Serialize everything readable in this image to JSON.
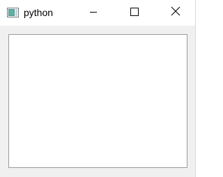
{
  "window": {
    "title": "python",
    "icon": "tk-window-icon",
    "controls": {
      "minimize_icon": "minimize-icon",
      "maximize_icon": "maximize-icon",
      "close_icon": "close-icon"
    }
  },
  "content": {
    "text_value": ""
  },
  "colors": {
    "titlebar": "#ffffff",
    "client_background": "#f0f0f0",
    "text_area_background": "#ffffff",
    "text_area_border": "#9a9a9a"
  }
}
